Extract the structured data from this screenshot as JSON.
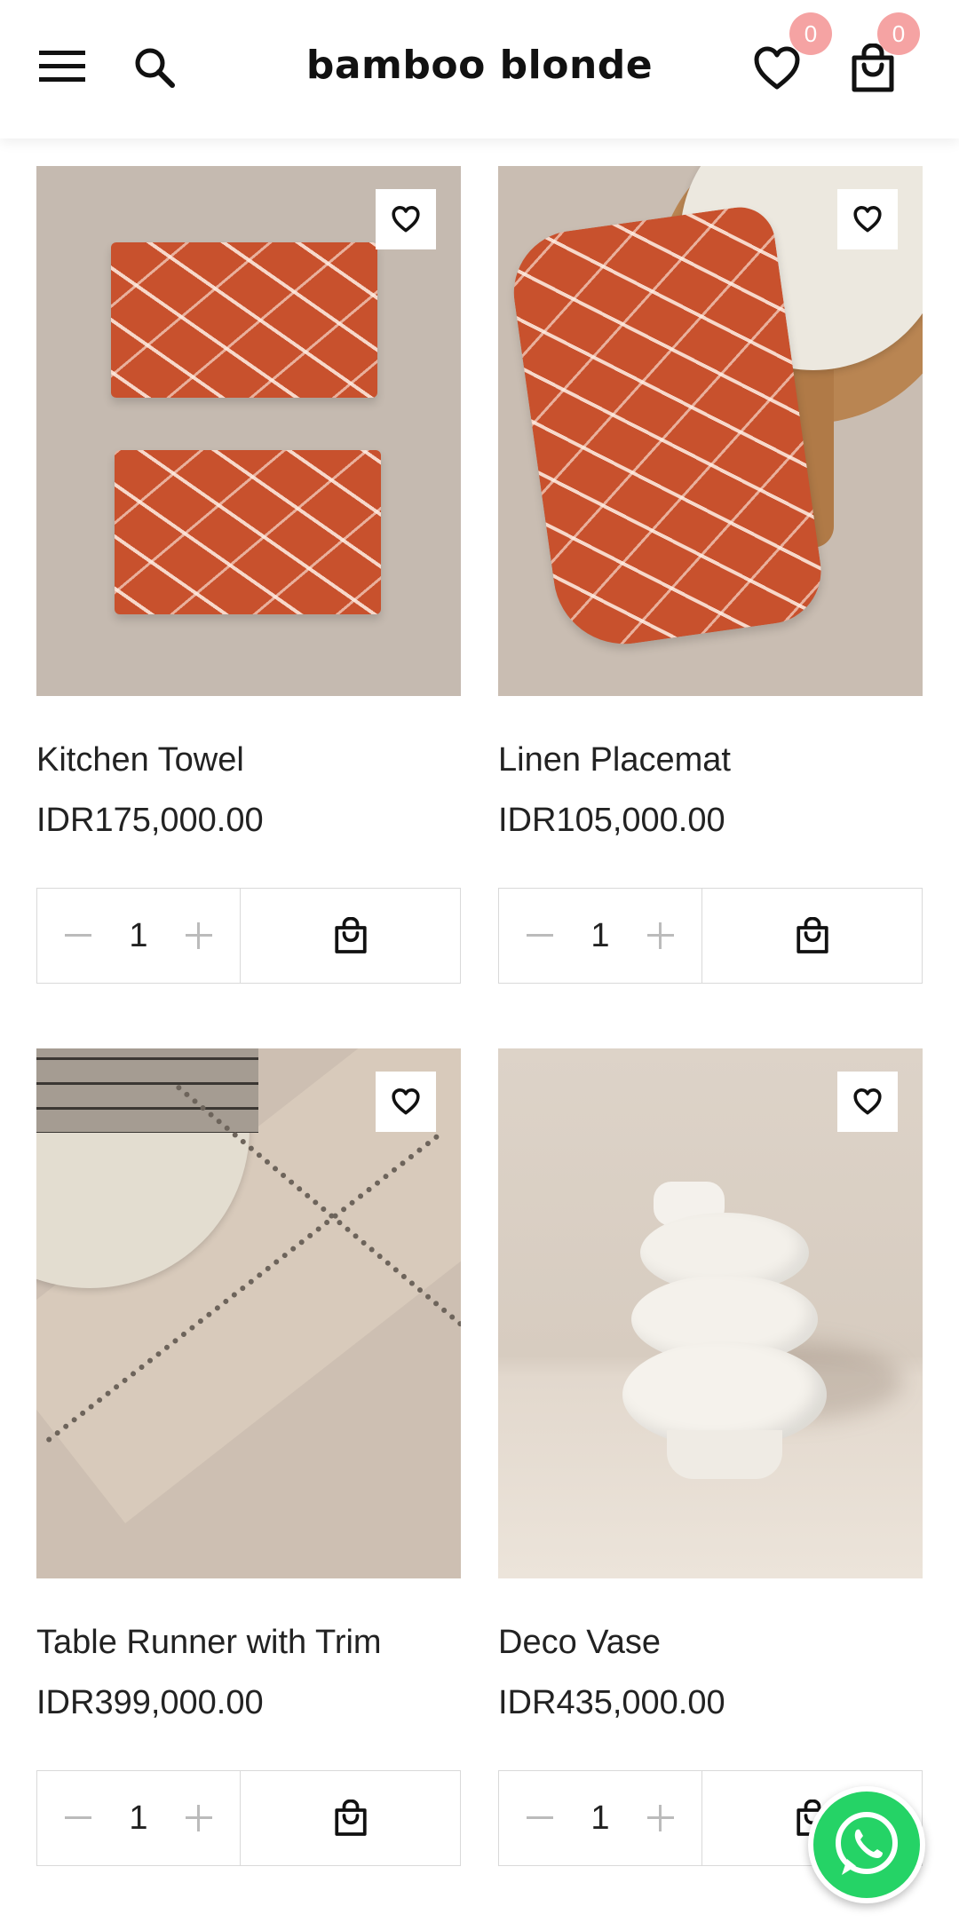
{
  "header": {
    "brand": "bamboo blonde",
    "wishlist_count": "0",
    "cart_count": "0"
  },
  "products": [
    {
      "name": "Kitchen Towel",
      "price": "IDR175,000.00",
      "qty": "1"
    },
    {
      "name": "Linen Placemat",
      "price": "IDR105,000.00",
      "qty": "1"
    },
    {
      "name": "Table Runner with Trim",
      "price": "IDR399,000.00",
      "qty": "1"
    },
    {
      "name": "Deco Vase",
      "price": "IDR435,000.00",
      "qty": "1"
    }
  ],
  "colors": {
    "badge": "#f5a3a3",
    "whatsapp": "#25d366",
    "towel": "#c8512d"
  }
}
